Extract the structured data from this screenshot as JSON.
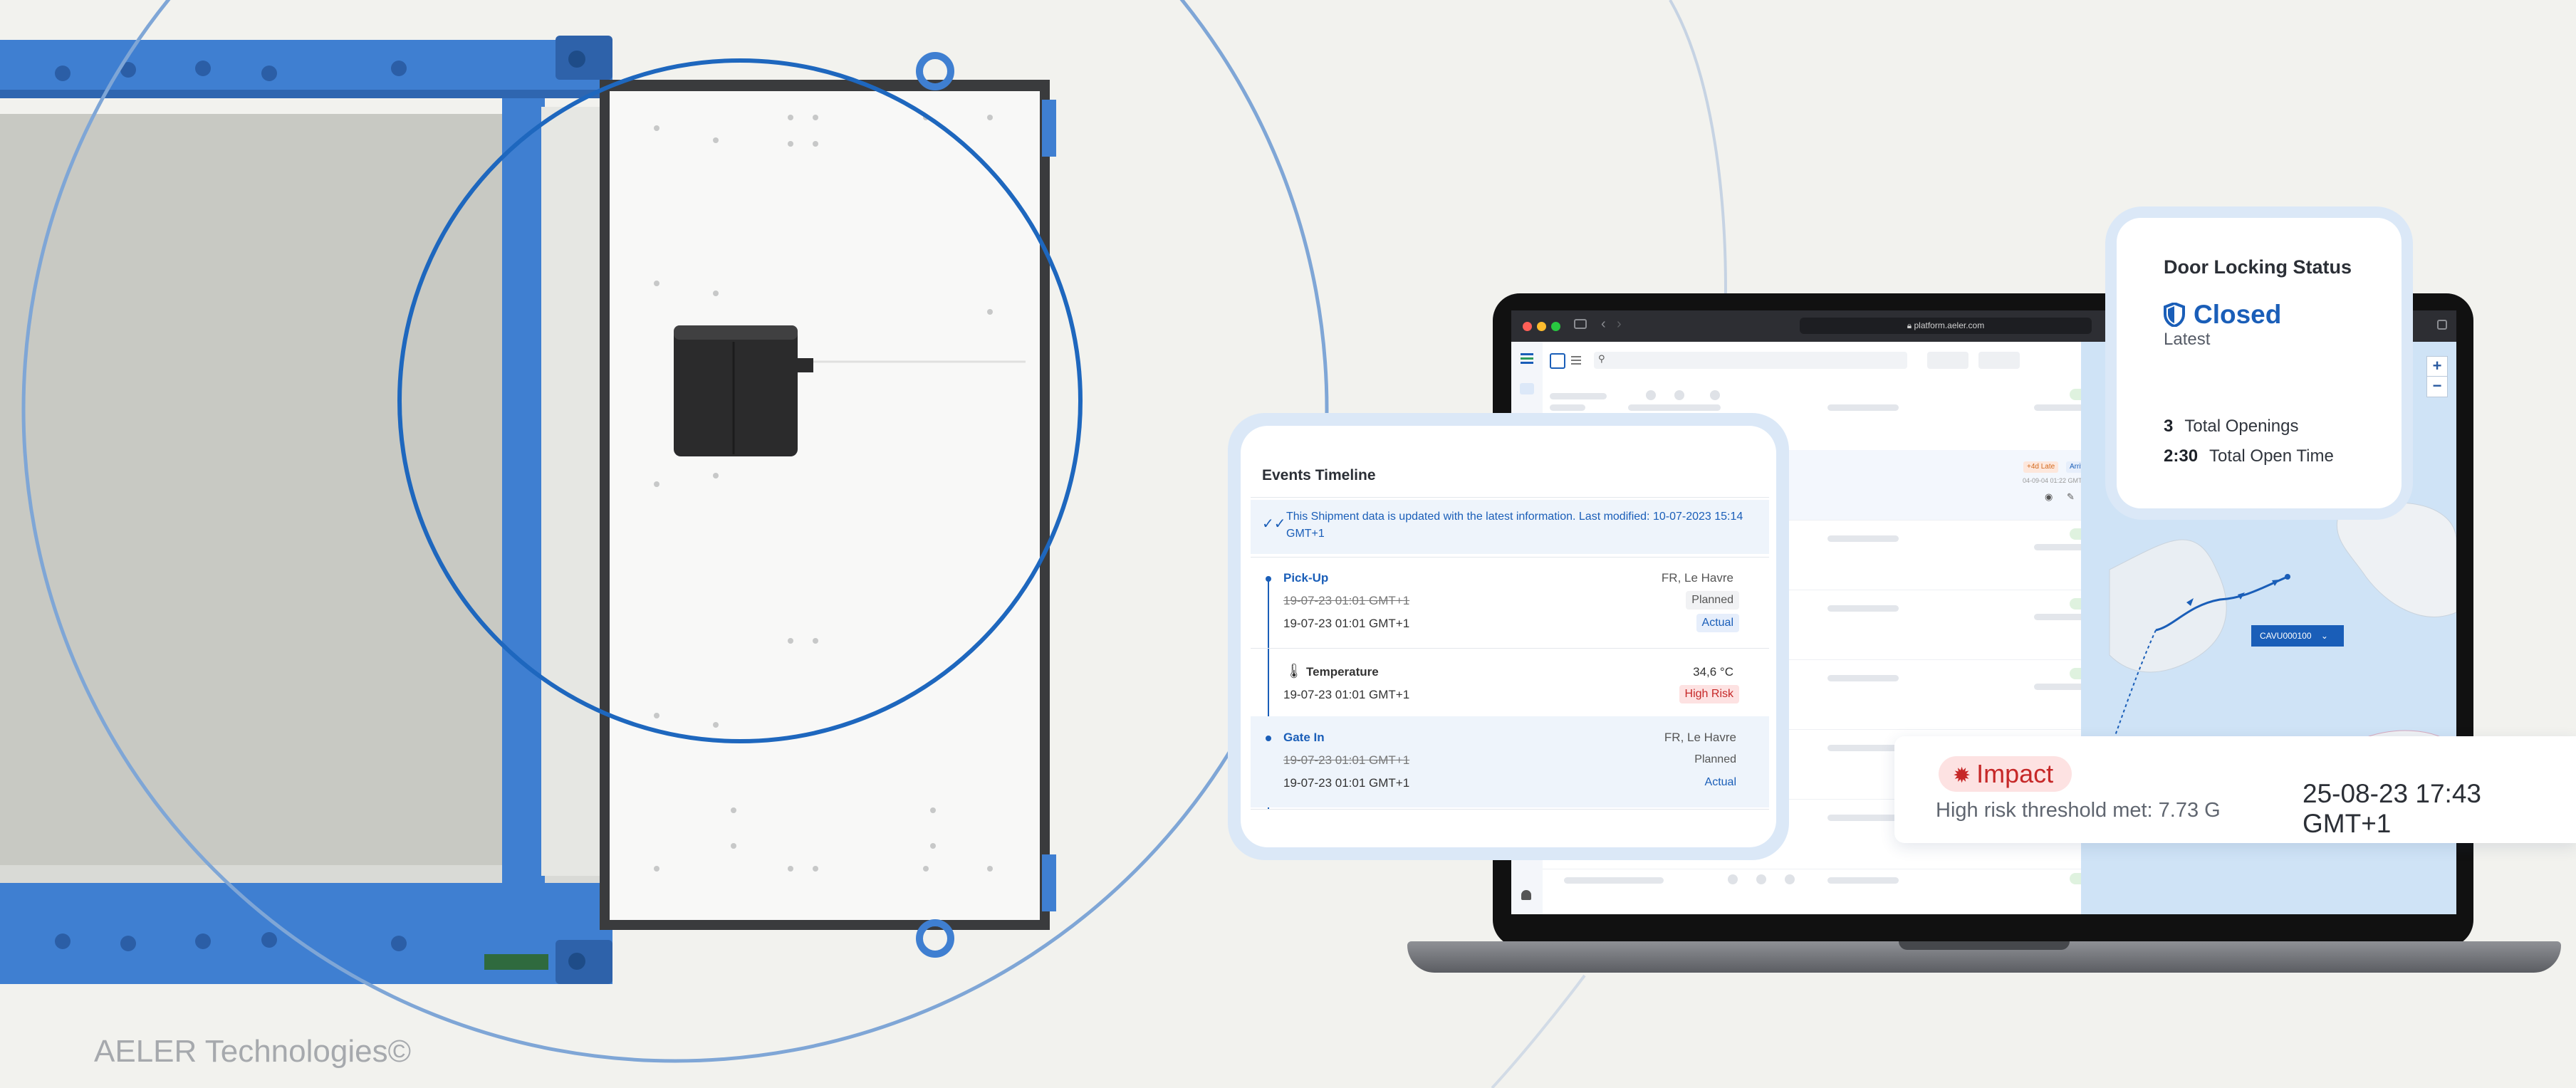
{
  "brand": {
    "footer": "AELER Technologies©"
  },
  "browser": {
    "url": "platform.aeler.com"
  },
  "map": {
    "container_tag": "CAVU000100",
    "zoom_in": "+",
    "zoom_out": "−"
  },
  "door_locking": {
    "title": "Door Locking Status",
    "status": "Closed",
    "status_sub": "Latest",
    "openings_value": "3",
    "openings_label": "Total Openings",
    "open_time_value": "2:30",
    "open_time_label": "Total Open Time"
  },
  "events_timeline": {
    "title": "Events Timeline",
    "notice": "This Shipment data is updated with the latest information.   Last modified:  10-07-2023 15:14 GMT+1",
    "events": [
      {
        "name": "Pick-Up",
        "location": "FR, Le Havre",
        "planned_time": "19-07-23  01:01 GMT+1",
        "planned_label": "Planned",
        "actual_time": "19-07-23  01:01 GMT+1",
        "actual_label": "Actual"
      },
      {
        "name": "Temperature",
        "value": "34,6 °C",
        "time": "19-07-23  01:01 GMT+1",
        "risk_label": "High Risk"
      },
      {
        "name": "Gate In",
        "location": "FR, Le Havre",
        "planned_time": "19-07-23  01:01 GMT+1",
        "planned_label": "Planned",
        "actual_time": "19-07-23  01:01 GMT+1",
        "actual_label": "Actual"
      }
    ]
  },
  "impact": {
    "label": "Impact",
    "description": "High risk threshold met: 7.73 G",
    "timestamp": "25-08-23 17:43 GMT+1"
  },
  "list_row_badges": {
    "late": "+4d Late",
    "arriving": "Arriving",
    "date": "04-09-04 01:22 GMT+1"
  },
  "colors": {
    "accent": "#1a5eb8",
    "container_blue": "#3f7fd1",
    "background": "#f2f2ee",
    "risk_red": "#c62828",
    "ok_green": "#dff2df"
  }
}
